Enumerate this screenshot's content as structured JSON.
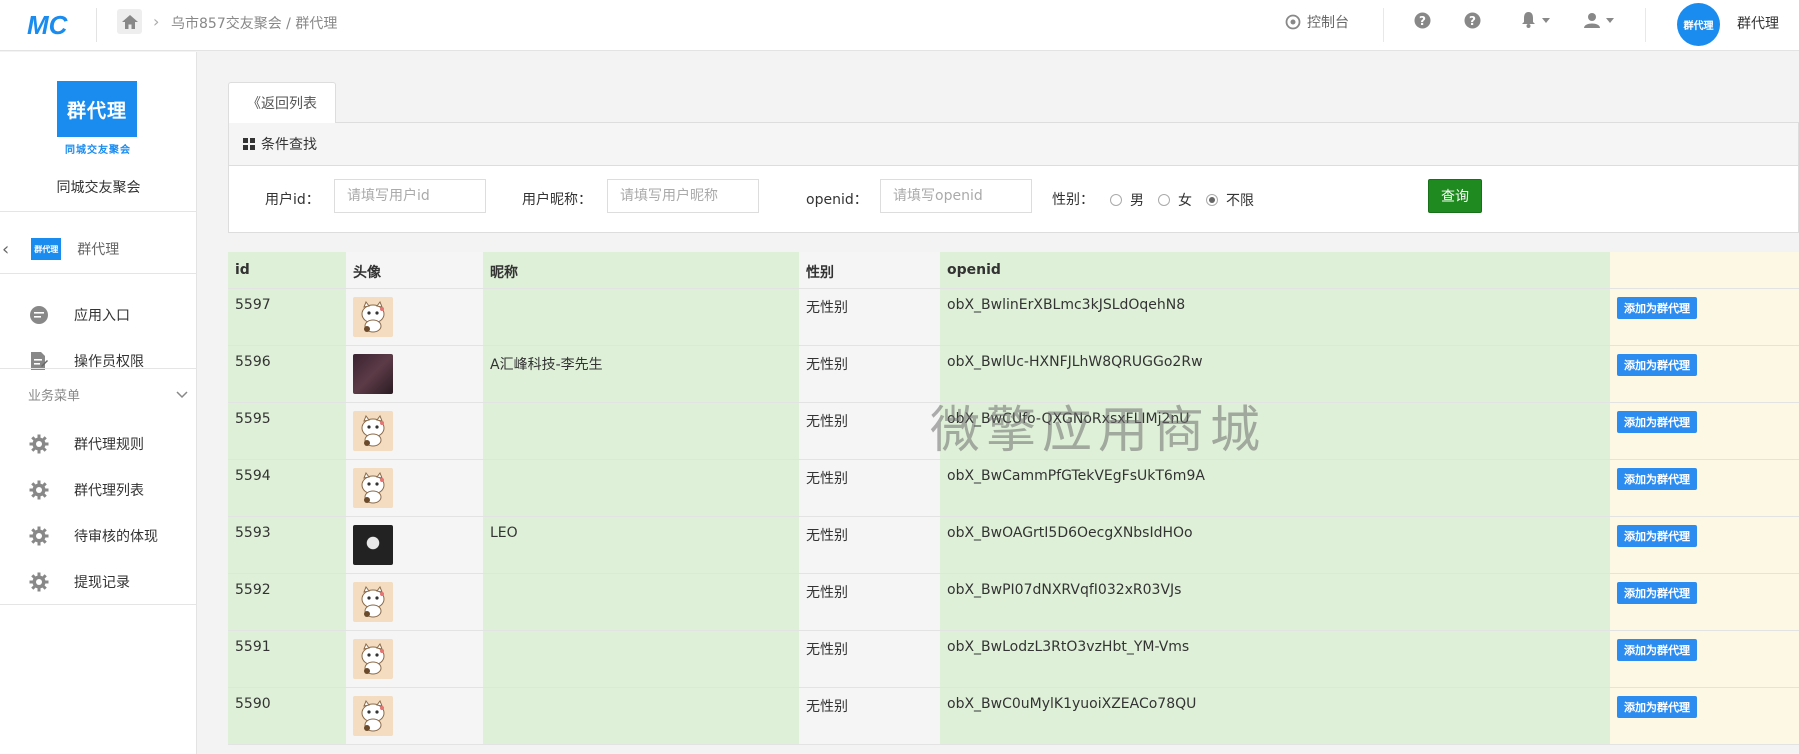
{
  "header": {
    "breadcrumb": [
      "乌市857交友聚会",
      "群代理"
    ],
    "console_label": "控制台",
    "user_name": "群代理",
    "avatar_text": "群代理"
  },
  "sidebar": {
    "app_logo_text": "群代理",
    "app_logo_sub": "同城交友聚会",
    "app_name": "同城交友聚会",
    "current_module": "群代理",
    "current_module_icon_text": "群代理",
    "items": [
      {
        "label": "应用入口",
        "icon": "chat-bubble-icon"
      },
      {
        "label": "操作员权限",
        "icon": "document-edit-icon"
      }
    ],
    "group_label": "业务菜单",
    "group_items": [
      {
        "label": "群代理规则",
        "icon": "gear-icon"
      },
      {
        "label": "群代理列表",
        "icon": "gear-icon"
      },
      {
        "label": "待审核的体现",
        "icon": "gear-icon"
      },
      {
        "label": "提现记录",
        "icon": "gear-icon"
      }
    ]
  },
  "main": {
    "back_tab": "《返回列表",
    "panel_title": "条件查找",
    "filters": {
      "user_id_label": "用户id：",
      "user_id_placeholder": "请填写用户id",
      "nickname_label": "用户昵称：",
      "nickname_placeholder": "请填写用户昵称",
      "openid_label": "openid：",
      "openid_placeholder": "请填写openid",
      "gender_label": "性别：",
      "gender_options": [
        "男",
        "女",
        "不限"
      ],
      "gender_selected": "不限",
      "query_button": "查询"
    },
    "table": {
      "headers": [
        "id",
        "头像",
        "昵称",
        "性别",
        "openid",
        ""
      ],
      "action_label": "添加为群代理",
      "rows": [
        {
          "id": "5597",
          "avatar": "cat",
          "nickname": "",
          "gender": "无性别",
          "openid": "obX_BwlinErXBLmc3kJSLdOqehN8"
        },
        {
          "id": "5596",
          "avatar": "dark1",
          "nickname": "A汇峰科技-李先生",
          "gender": "无性别",
          "openid": "obX_BwlUc-HXNFJLhW8QRUGGo2Rw"
        },
        {
          "id": "5595",
          "avatar": "cat",
          "nickname": "",
          "gender": "无性别",
          "openid": "obX_BwCUfo-QXGNoRxsxFLIMj2nU"
        },
        {
          "id": "5594",
          "avatar": "cat",
          "nickname": "",
          "gender": "无性别",
          "openid": "obX_BwCammPfGTekVEgFsUkT6m9A"
        },
        {
          "id": "5593",
          "avatar": "dark2",
          "nickname": "LEO",
          "gender": "无性别",
          "openid": "obX_BwOAGrtI5D6OecgXNbsIdHOo"
        },
        {
          "id": "5592",
          "avatar": "cat",
          "nickname": "",
          "gender": "无性别",
          "openid": "obX_BwPI07dNXRVqfI032xR03VJs"
        },
        {
          "id": "5591",
          "avatar": "cat",
          "nickname": "",
          "gender": "无性别",
          "openid": "obX_BwLodzL3RtO3vzHbt_YM-Vms"
        },
        {
          "id": "5590",
          "avatar": "cat",
          "nickname": "",
          "gender": "无性别",
          "openid": "obX_BwC0uMylK1yuoiXZEACo78QU"
        }
      ]
    },
    "watermark": "微擎应用商城"
  },
  "colors": {
    "primary": "#1a8cf0",
    "query_button": "#1f8a1f",
    "action_button": "#2d8cf0",
    "col_green": "#dff0d8",
    "col_gray": "#f5f5f5",
    "col_yellow": "#fcf8e3"
  }
}
